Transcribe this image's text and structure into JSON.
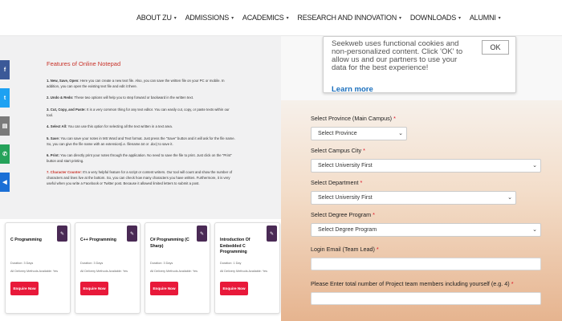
{
  "nav": [
    {
      "label": "ABOUT ZU"
    },
    {
      "label": "ADMISSIONS"
    },
    {
      "label": "ACADEMICS"
    },
    {
      "label": "RESEARCH AND INNOVATION"
    },
    {
      "label": "DOWNLOADS"
    },
    {
      "label": "ALUMNI"
    }
  ],
  "notepad": {
    "title": "Features of Online Notepad",
    "items": [
      {
        "lead": "1. New, Save, Open:",
        "text": " Here you can create a new text file. Also, you can save the written file on your PC or mobile. In addition, you can open the existing text file and edit it there."
      },
      {
        "lead": "2. Undo & Redo:",
        "text": " These two options will help you to step forward or backward in the written text."
      },
      {
        "lead": "3. Cut, Copy, and Paste:",
        "text": " It is a very common thing for any text editor. You can easily cut, copy, or paste texts within our tool."
      },
      {
        "lead": "4. Select All:",
        "text": " You can use this option for selecting all the text written in a text area."
      },
      {
        "lead": "5. Save:",
        "text": " You can save your notes in MS Word and Text format. Just press the \"Save\" button and it will ask for the file name. So, you can give the file name with an extension(i.e. filename.txt or .doc) to save it."
      },
      {
        "lead": "6. Print:",
        "text": " You can directly print your notes through the application. No need to save the file to print. Just click on the \"Print\" button and start printing."
      },
      {
        "lead": "7. Character Counter:",
        "text": " It's a very helpful feature for a script or content writers. Our tool will count and show the number of characters and lines live at the bottom. So, you can check how many characters you have written. Furthermore, it is very useful when you write a Facebook or Twitter post. Because it allowed limited letters to submit a post."
      }
    ]
  },
  "social": [
    {
      "icon": "facebook-icon",
      "glyph": "f"
    },
    {
      "icon": "twitter-icon",
      "glyph": "t"
    },
    {
      "icon": "print-icon",
      "glyph": "▤"
    },
    {
      "icon": "whatsapp-icon",
      "glyph": "✆"
    },
    {
      "icon": "share-icon",
      "glyph": "◀"
    }
  ],
  "courses": [
    {
      "title": "C Programming",
      "duration": "Duration: 3 Days",
      "delivery": "All Delivery Methods Available: Yes",
      "button": "Enquire Now"
    },
    {
      "title": "C++ Programming",
      "duration": "Duration: 3 Days",
      "delivery": "All Delivery Methods Available: Yes",
      "button": "Enquire Now"
    },
    {
      "title": "C# Programming (C Sharp)",
      "duration": "Duration: 3 Days",
      "delivery": "All Delivery Methods Available: Yes",
      "button": "Enquire Now"
    },
    {
      "title": "Introduction Of Embedded C Programming",
      "duration": "Duration: 1 Day",
      "delivery": "All Delivery Methods Available: Yes",
      "button": "Enquire Now"
    }
  ],
  "cookie": {
    "text": "Seekweb uses functional cookies and non-personalized content. Click 'OK' to allow us and our partners to use your data for the best experience!",
    "learn_more": "Learn more",
    "ok": "OK"
  },
  "form": {
    "province_label": "Select Province (Main Campus)",
    "province_value": "Select Province",
    "city_label": "Select Campus City",
    "city_value": "Select University First",
    "department_label": "Select Department",
    "department_value": "Select University First",
    "degree_label": "Select Degree Program",
    "degree_value": "Select Degree Program",
    "email_label": "Login Email (Team Lead)",
    "members_label": "Please Enter total number of Project team members including yourself (e.g. 4)",
    "required_mark": "*"
  },
  "colors": {
    "accent_red": "#e8193a",
    "title_red": "#c8332a",
    "badge_purple": "#4a2a55",
    "link_blue": "#1a6fbd"
  }
}
